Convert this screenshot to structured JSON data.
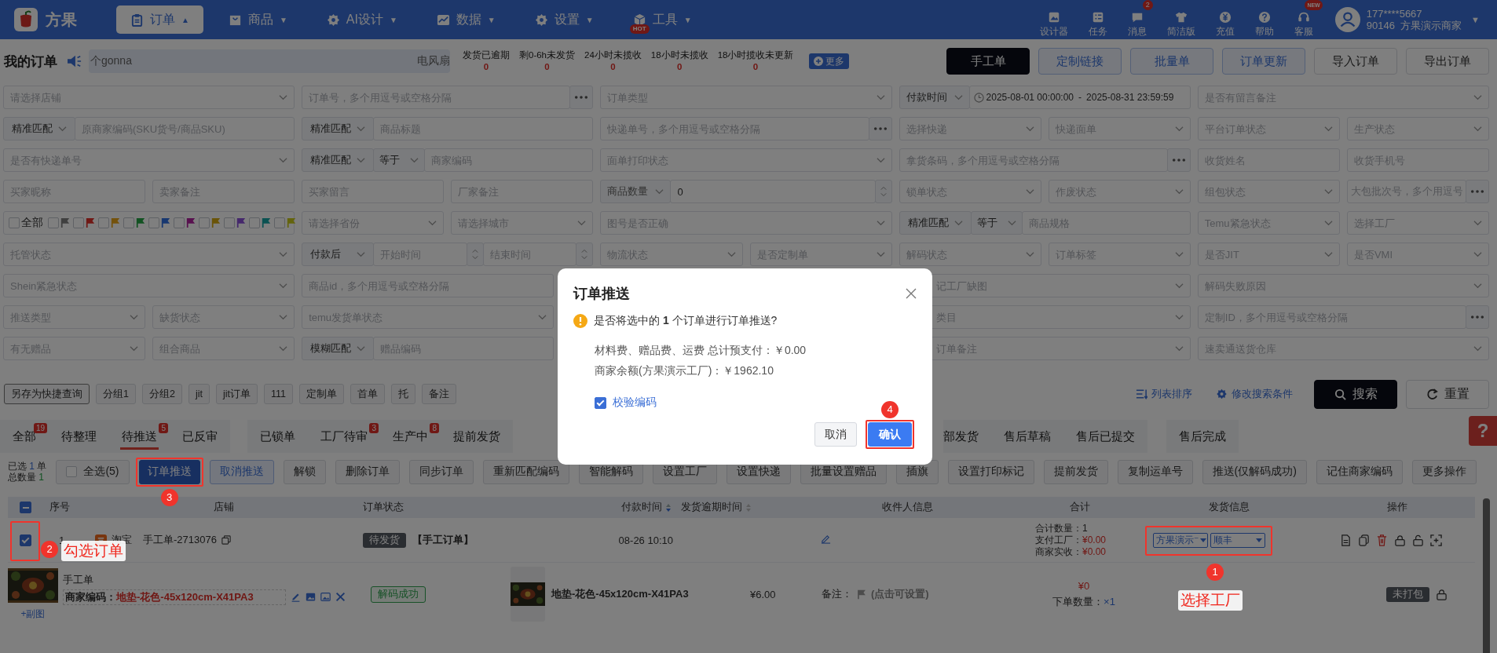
{
  "topbar": {
    "brand": "方果",
    "nav": [
      {
        "label": "订单",
        "caret": "▲",
        "selected": true
      },
      {
        "label": "商品",
        "caret": "▼",
        "selected": false
      },
      {
        "label": "AI设计",
        "caret": "▼",
        "selected": false
      },
      {
        "label": "数据",
        "caret": "▼",
        "selected": false
      },
      {
        "label": "设置",
        "caret": "▼",
        "selected": false
      },
      {
        "label": "工具",
        "caret": "▼",
        "selected": false,
        "badge": "HOT"
      }
    ],
    "tools": [
      {
        "label": "设计器"
      },
      {
        "label": "任务"
      },
      {
        "label": "消息",
        "badge": "2"
      },
      {
        "label": "简洁版"
      },
      {
        "label": "充值"
      },
      {
        "label": "帮助"
      },
      {
        "label": "客服",
        "badge": "NEW"
      }
    ],
    "user": {
      "phone": "177****5667",
      "account": "90146  方果演示商家",
      "caret": "▼"
    }
  },
  "header": {
    "title": "我的订单",
    "notice": [
      "个gonna",
      "电风扇"
    ],
    "stats": [
      {
        "label": "发货已逾期",
        "value": "0"
      },
      {
        "label": "剩0-6h未发货",
        "value": "0"
      },
      {
        "label": "24小时未揽收",
        "value": "0"
      },
      {
        "label": "18小时未揽收",
        "value": "0"
      },
      {
        "label": "18小时揽收未更新",
        "value": "0"
      }
    ],
    "more": "更多",
    "buttons": [
      {
        "label": "手工单",
        "kind": "dark"
      },
      {
        "label": "定制链接",
        "kind": "outline"
      },
      {
        "label": "批量单",
        "kind": "outline"
      },
      {
        "label": "订单更新",
        "kind": "outline"
      },
      {
        "label": "导入订单",
        "kind": "plain"
      },
      {
        "label": "导出订单",
        "kind": "plain"
      }
    ]
  },
  "filters": [
    [
      {
        "kind": "select",
        "placeholder": "请选择店铺"
      },
      {
        "kind": "input-more",
        "placeholder": "订单号，多个用逗号或空格分隔"
      },
      {
        "kind": "select",
        "placeholder": "订单类型"
      },
      {
        "kind": "date-range",
        "mode": "付款时间",
        "start": "2025-08-01 00:00:00",
        "sep": "-",
        "end": "2025-08-31 23:59:59"
      },
      {
        "kind": "select",
        "placeholder": "是否有留言备注"
      }
    ],
    [
      {
        "kind": "match",
        "mode": "精准匹配",
        "placeholder": "原商家编码(SKU货号/商品SKU)"
      },
      {
        "kind": "match",
        "mode": "精准匹配",
        "placeholder": "商品标题"
      },
      {
        "kind": "input-more",
        "placeholder": "快递单号，多个用逗号或空格分隔"
      },
      {
        "kind": "select",
        "placeholder": "选择快递"
      },
      {
        "kind": "select",
        "placeholder": "快递面单"
      },
      {
        "kind": "select",
        "placeholder": "平台订单状态"
      },
      {
        "kind": "select",
        "placeholder": "生产状态"
      }
    ],
    [
      {
        "kind": "select",
        "placeholder": "是否有快递单号"
      },
      {
        "kind": "match-eq",
        "mode": "精准匹配",
        "op": "等于",
        "placeholder": "商家编码"
      },
      {
        "kind": "select",
        "placeholder": "面单打印状态"
      },
      {
        "kind": "input-more",
        "placeholder": "拿货条码，多个用逗号或空格分隔"
      },
      {
        "kind": "input",
        "placeholder": "收货姓名"
      },
      {
        "kind": "input",
        "placeholder": "收货手机号"
      }
    ],
    [
      {
        "kind": "input",
        "placeholder": "买家昵称"
      },
      {
        "kind": "input",
        "placeholder": "卖家备注"
      },
      {
        "kind": "input",
        "placeholder": "买家留言"
      },
      {
        "kind": "input",
        "placeholder": "厂家备注"
      },
      {
        "kind": "number",
        "mode": "商品数量",
        "value": "0"
      },
      {
        "kind": "select",
        "placeholder": "锁单状态"
      },
      {
        "kind": "select",
        "placeholder": "作废状态"
      },
      {
        "kind": "select",
        "placeholder": "组包状态"
      },
      {
        "kind": "input-more",
        "placeholder": "大包批次号，多个用逗号"
      }
    ],
    [
      {
        "kind": "flags",
        "all": {
          "label": "全部",
          "checked": false
        },
        "flags": [
          {
            "color": "#404040",
            "checked": false
          },
          {
            "color": "#701815",
            "checked": false
          },
          {
            "color": "#74520c",
            "checked": false
          },
          {
            "color": "#125222",
            "checked": false
          },
          {
            "color": "#183870",
            "checked": false
          },
          {
            "color": "#58114f",
            "checked": false
          },
          {
            "color": "#6a5408",
            "checked": false
          },
          {
            "color": "#45286c",
            "checked": false
          },
          {
            "color": "#0b5252",
            "checked": false
          },
          {
            "color": "#64640d",
            "checked": false
          }
        ]
      },
      {
        "kind": "select",
        "placeholder": "请选择省份"
      },
      {
        "kind": "select",
        "placeholder": "请选择城市"
      },
      {
        "kind": "select",
        "placeholder": "图号是否正确"
      },
      {
        "kind": "match-eq",
        "mode": "精准匹配",
        "op": "等于",
        "placeholder": "商品规格"
      },
      {
        "kind": "select",
        "placeholder": "Temu紧急状态"
      },
      {
        "kind": "select",
        "placeholder": "选择工厂"
      }
    ],
    [
      {
        "kind": "select",
        "placeholder": "托管状态"
      },
      {
        "kind": "time-range",
        "mode": "付款后",
        "start": {
          "placeholder": "开始时间"
        },
        "end": {
          "placeholder": "结束时间"
        }
      },
      {
        "kind": "select",
        "placeholder": "物流状态"
      },
      {
        "kind": "select",
        "placeholder": "是否定制单"
      },
      {
        "kind": "select",
        "placeholder": "解码状态"
      },
      {
        "kind": "select",
        "placeholder": "订单标签"
      },
      {
        "kind": "select",
        "placeholder": "是否JIT"
      },
      {
        "kind": "select",
        "placeholder": "是否VMI"
      }
    ],
    [
      {
        "kind": "select",
        "placeholder": "Shein紧急状态"
      },
      {
        "kind": "input",
        "placeholder": "商品id，多个用逗号或空格分隔"
      },
      {
        "kind": "select",
        "placeholder": "记工厂缺图"
      },
      {
        "kind": "select",
        "placeholder": "解码失败原因"
      }
    ],
    [
      {
        "kind": "select",
        "placeholder": "推送类型"
      },
      {
        "kind": "select",
        "placeholder": "缺货状态"
      },
      {
        "kind": "select",
        "placeholder": "temu发货单状态"
      },
      {
        "kind": "select",
        "placeholder": "类目"
      },
      {
        "kind": "input-more",
        "placeholder": "定制ID，多个用逗号或空格分隔"
      }
    ],
    [
      {
        "kind": "select",
        "placeholder": "有无赠品"
      },
      {
        "kind": "select",
        "placeholder": "组合商品"
      },
      {
        "kind": "match",
        "mode": "模糊匹配",
        "placeholder": "赠品编码"
      },
      {
        "kind": "select",
        "placeholder": "订单备注"
      },
      {
        "kind": "select",
        "placeholder": "速卖通送货仓库"
      }
    ]
  ],
  "quick": {
    "tags": [
      "另存为快捷查询",
      "分组1",
      "分组2",
      "jit",
      "jit订单",
      "111",
      "定制单",
      "首单",
      "托",
      "备注"
    ],
    "links": [
      "列表排序",
      "修改搜索条件"
    ],
    "search": "搜索",
    "reset": "重置"
  },
  "tabs": [
    {
      "label": "全部",
      "count": "19",
      "selected": false
    },
    {
      "label": "待整理",
      "selected": false
    },
    {
      "label": "待推送",
      "count": "5",
      "selected": true
    },
    {
      "label": "已反审",
      "selected": false
    },
    {
      "label": "已锁单",
      "selected": false
    },
    {
      "label": "工厂待审",
      "count": "3",
      "selected": false
    },
    {
      "label": "生产中",
      "count": "8",
      "selected": false
    },
    {
      "label": "提前发货",
      "selected": false
    },
    {
      "label": "部发货",
      "selected": false
    },
    {
      "label": "售后草稿",
      "selected": false
    },
    {
      "label": "售后已提交",
      "selected": false
    },
    {
      "label": "售后完成",
      "selected": false
    }
  ],
  "actions": {
    "selected": {
      "prefix": "已选",
      "count": "1",
      "suffix": "单"
    },
    "total": {
      "label": "总数量",
      "count": "1"
    },
    "buttons": [
      {
        "label": "全选(5)",
        "kind": "checkbox",
        "checked": false
      },
      {
        "label": "订单推送",
        "kind": "primary",
        "step": "3"
      },
      {
        "label": "取消推送",
        "kind": "outline"
      },
      {
        "label": "解锁",
        "kind": "plain"
      },
      {
        "label": "删除订单",
        "kind": "plain"
      },
      {
        "label": "同步订单",
        "kind": "plain"
      },
      {
        "label": "重新匹配编码",
        "kind": "plain"
      },
      {
        "label": "智能解码",
        "kind": "plain"
      },
      {
        "label": "设置工厂",
        "kind": "plain"
      },
      {
        "label": "设置快递",
        "kind": "plain"
      },
      {
        "label": "批量设置赠品",
        "kind": "plain"
      },
      {
        "label": "插旗",
        "kind": "plain"
      },
      {
        "label": "设置打印标记",
        "kind": "plain"
      },
      {
        "label": "提前发货",
        "kind": "plain"
      },
      {
        "label": "复制运单号",
        "kind": "plain"
      },
      {
        "label": "推送(仅解码成功)",
        "kind": "plain"
      },
      {
        "label": "记住商家编码",
        "kind": "plain"
      },
      {
        "label": "更多操作",
        "kind": "plain"
      }
    ]
  },
  "table": {
    "indeterminate": true,
    "columns": [
      "序号",
      "店铺",
      "订单状态",
      "付款时间",
      "发货逾期时间",
      "收件人信息",
      "合计",
      "发货信息",
      "操作"
    ],
    "order": {
      "checked": true,
      "step": "2",
      "step_label": "勾选订单",
      "index": "1",
      "platform": "淘宝",
      "order_no": "手工单-2713076",
      "status": "待发货",
      "type": "【手工订单】",
      "paid_at": "08-26 10:10",
      "totals": [
        {
          "label": "合计数量：",
          "value": "1",
          "kind": "plain"
        },
        {
          "label": "支付工厂：",
          "value": "¥0.00",
          "kind": "money"
        },
        {
          "label": "商家实收：",
          "value": "¥0.00",
          "kind": "money"
        }
      ],
      "shipping": {
        "factory": "方果演示⁻",
        "courier": "顺丰",
        "step": "1",
        "step_label": "选择工厂"
      }
    },
    "item": {
      "title": "手工单",
      "code_label": "商家编码：",
      "code": "地垫-花色-45x120cm-X41PA3",
      "extra": "+副图",
      "decode": "解码成功",
      "name": "地垫-花色-45x120cm-X41PA3",
      "price": "¥6.00",
      "remark_label": "备注：",
      "remark_hint": "(点击可设置)",
      "amount": "¥0",
      "qty_label": "下单数量：",
      "qty": "×1",
      "pack": "未打包"
    }
  },
  "modal": {
    "title": "订单推送",
    "question": "是否将选中的 **1** 个订单进行订单推送?",
    "lines": [
      "材料费、赠品费、运费 总计预支付：￥0.00",
      "商家余额(方果演示工厂)：￥1962.10"
    ],
    "check": {
      "label": "校验编码",
      "checked": true
    },
    "cancel": "取消",
    "confirm": "确认",
    "confirm_step": "4"
  },
  "help_tab": "?"
}
